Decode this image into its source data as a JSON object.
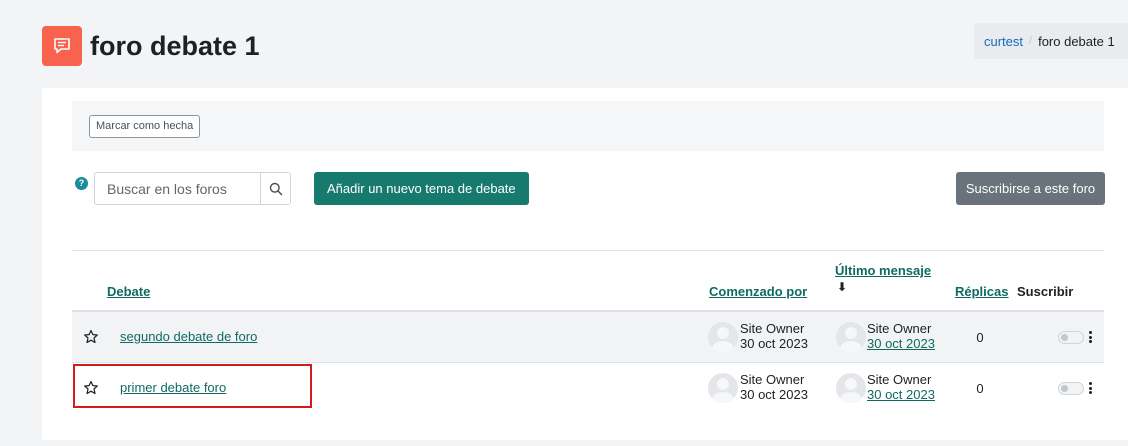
{
  "page": {
    "title": "foro debate 1",
    "icon": "forum-icon",
    "accent_color": "#f7634d"
  },
  "breadcrumb": {
    "items": [
      "curtest",
      "foro debate 1"
    ]
  },
  "activity": {
    "mark_done_label": "Marcar como hecha"
  },
  "toolbar": {
    "search_placeholder": "Buscar en los foros",
    "add_topic_label": "Añadir un nuevo tema de debate",
    "subscribe_label": "Suscribirse a este foro",
    "primary_color": "#177a6f"
  },
  "table": {
    "headers": {
      "discussion": "Debate",
      "started_by": "Comenzado por",
      "last_post_line1": "Último mensaje",
      "sort_arrow": "⬇",
      "replies": "Réplicas",
      "subscribe": "Suscribir"
    },
    "rows": [
      {
        "topic": "segundo debate de foro",
        "starter_name": "Site Owner",
        "starter_date": "30 oct 2023",
        "last_name": "Site Owner",
        "last_date": "30 oct 2023",
        "replies": "0",
        "subscribed": false
      },
      {
        "topic": "primer debate foro",
        "starter_name": "Site Owner",
        "starter_date": "30 oct 2023",
        "last_name": "Site Owner",
        "last_date": "30 oct 2023",
        "replies": "0",
        "subscribed": false
      }
    ]
  }
}
